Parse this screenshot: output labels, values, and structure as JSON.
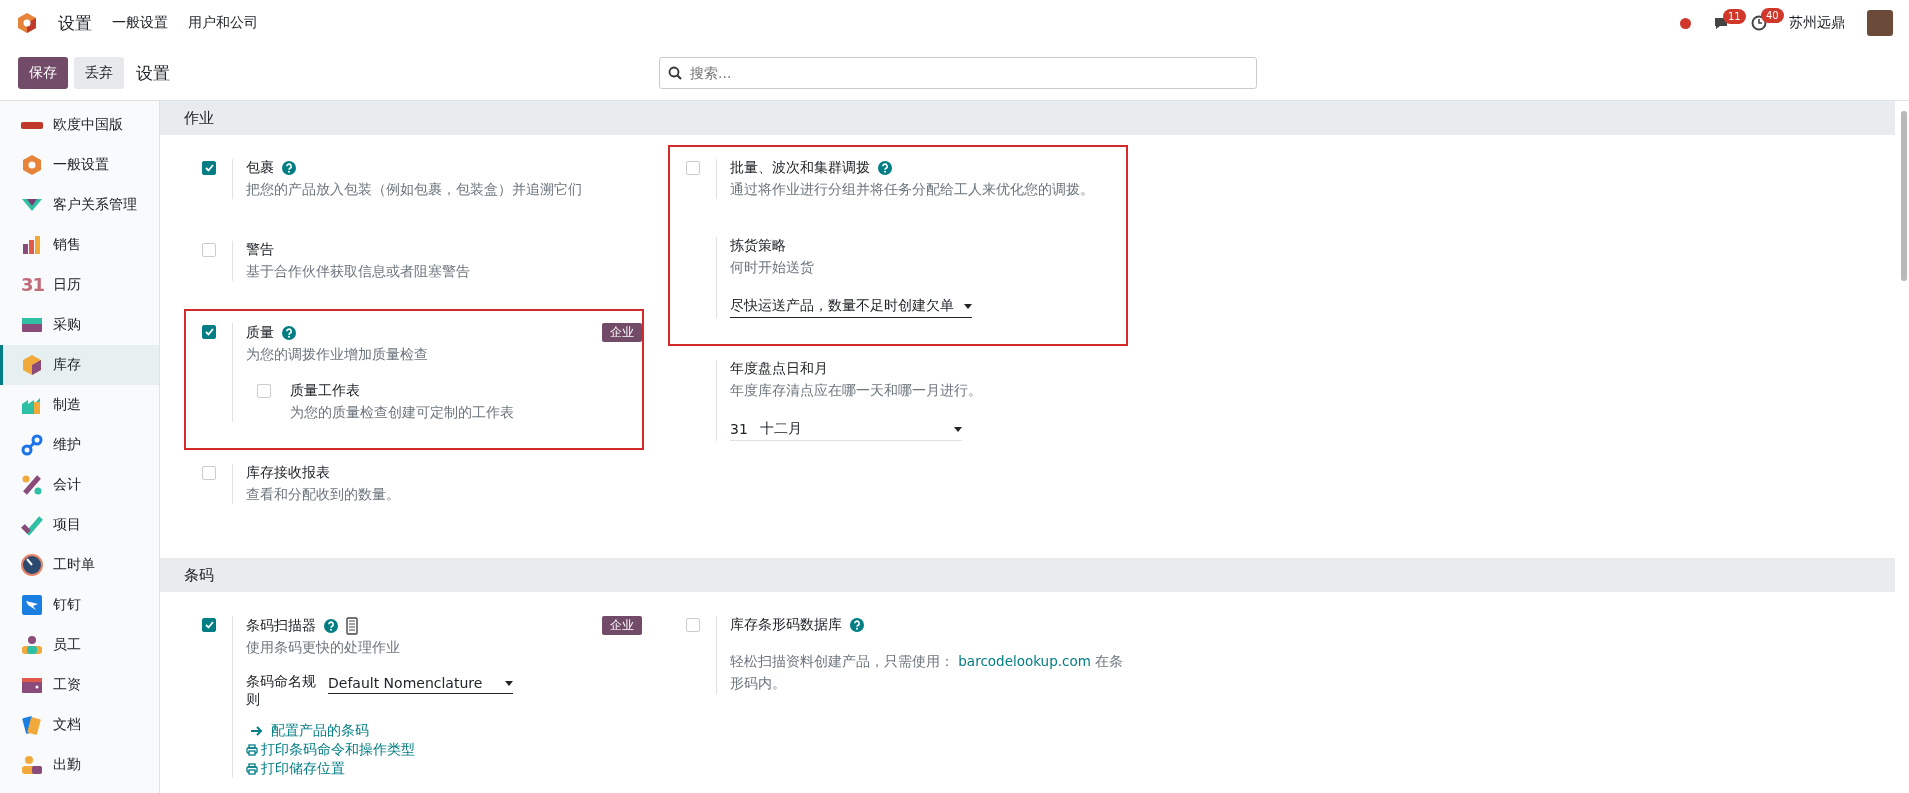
{
  "navbar": {
    "brand": "设置",
    "menu": [
      "一般设置",
      "用户和公司"
    ],
    "chat_count": "11",
    "activity_count": "40",
    "user": "苏州远鼎"
  },
  "control_panel": {
    "buttons": [
      {
        "label": "保存",
        "kind": "primary"
      },
      {
        "label": "丢弃",
        "kind": "secondary"
      }
    ],
    "breadcrumb": "设置",
    "search": {
      "placeholder": "搜索..."
    }
  },
  "sidebar": {
    "items": [
      {
        "label": "欧度中国版",
        "selected": false
      },
      {
        "label": "一般设置",
        "selected": false
      },
      {
        "label": "客户关系管理",
        "selected": false
      },
      {
        "label": "销售",
        "selected": false
      },
      {
        "label": "日历",
        "selected": false,
        "icon_text": "31"
      },
      {
        "label": "采购",
        "selected": false
      },
      {
        "label": "库存",
        "selected": true
      },
      {
        "label": "制造",
        "selected": false
      },
      {
        "label": "维护",
        "selected": false
      },
      {
        "label": "会计",
        "selected": false
      },
      {
        "label": "项目",
        "selected": false
      },
      {
        "label": "工时单",
        "selected": false
      },
      {
        "label": "钉钉",
        "selected": false
      },
      {
        "label": "员工",
        "selected": false
      },
      {
        "label": "工资",
        "selected": false
      },
      {
        "label": "文档",
        "selected": false
      },
      {
        "label": "出勤",
        "selected": false
      }
    ]
  },
  "sections": [
    {
      "title": "作业",
      "columns": [
        [
          {
            "kind": "setting",
            "toggle": true,
            "checked": true,
            "title": "包裹",
            "help": true,
            "description": "把您的产品放入包装（例如包裹，包装盒）并追溯它们"
          },
          {
            "kind": "setting",
            "toggle": true,
            "checked": false,
            "title": "警告",
            "description": "基于合作伙伴获取信息或者阻塞警告"
          },
          {
            "kind": "highlight_frame",
            "settings": [
              {
                "kind": "setting",
                "toggle": true,
                "checked": true,
                "title": "质量",
                "help": true,
                "badge": "企业",
                "description": "为您的调拨作业增加质量检查",
                "children": [
                  {
                    "toggle": true,
                    "checked": false,
                    "title": "质量工作表",
                    "description": "为您的质量检查创建可定制的工作表"
                  }
                ]
              }
            ]
          },
          {
            "kind": "setting",
            "toggle": true,
            "checked": false,
            "title": "库存接收报表",
            "description": "查看和分配收到的数量。"
          }
        ],
        [
          {
            "kind": "highlight_frame",
            "settings": [
              {
                "kind": "setting",
                "toggle": true,
                "checked": false,
                "title": "批量、波次和集群调拨",
                "help": true,
                "description": "通过将作业进行分组并将任务分配给工人来优化您的调拨。"
              },
              {
                "kind": "setting",
                "toggle": false,
                "title": "拣货策略",
                "description": "何时开始送货",
                "fields": [
                  {
                    "kind": "select",
                    "value": "尽快运送产品，数量不足时创建欠单"
                  }
                ]
              }
            ]
          },
          {
            "kind": "setting",
            "toggle": false,
            "title": "年度盘点日和月",
            "description": "年度库存清点应在哪一天和哪一月进行。",
            "fields": [
              {
                "kind": "day_month",
                "day": "31",
                "month": "十二月"
              }
            ]
          }
        ]
      ]
    },
    {
      "title": "条码",
      "columns": [
        [
          {
            "kind": "setting",
            "toggle": true,
            "checked": true,
            "title": "条码扫描器",
            "help": true,
            "device_icon": true,
            "badge": "企业",
            "description": "使用条码更快的处理作业",
            "fields": [
              {
                "kind": "select",
                "label": "条码命名规则",
                "value": "Default Nomenclature"
              }
            ],
            "links": [
              {
                "kind": "arrow",
                "label": "配置产品的条码"
              },
              {
                "kind": "print",
                "label": "打印条码命令和操作类型"
              },
              {
                "kind": "print",
                "label": "打印储存位置"
              }
            ]
          }
        ],
        [
          {
            "kind": "setting",
            "toggle": true,
            "checked": false,
            "title": "库存条形码数据库",
            "help": true,
            "description": "轻松扫描资料创建产品，只需使用：",
            "description_link": "barcodelookup.com",
            "description_after": "在条形码内。"
          }
        ]
      ]
    }
  ]
}
